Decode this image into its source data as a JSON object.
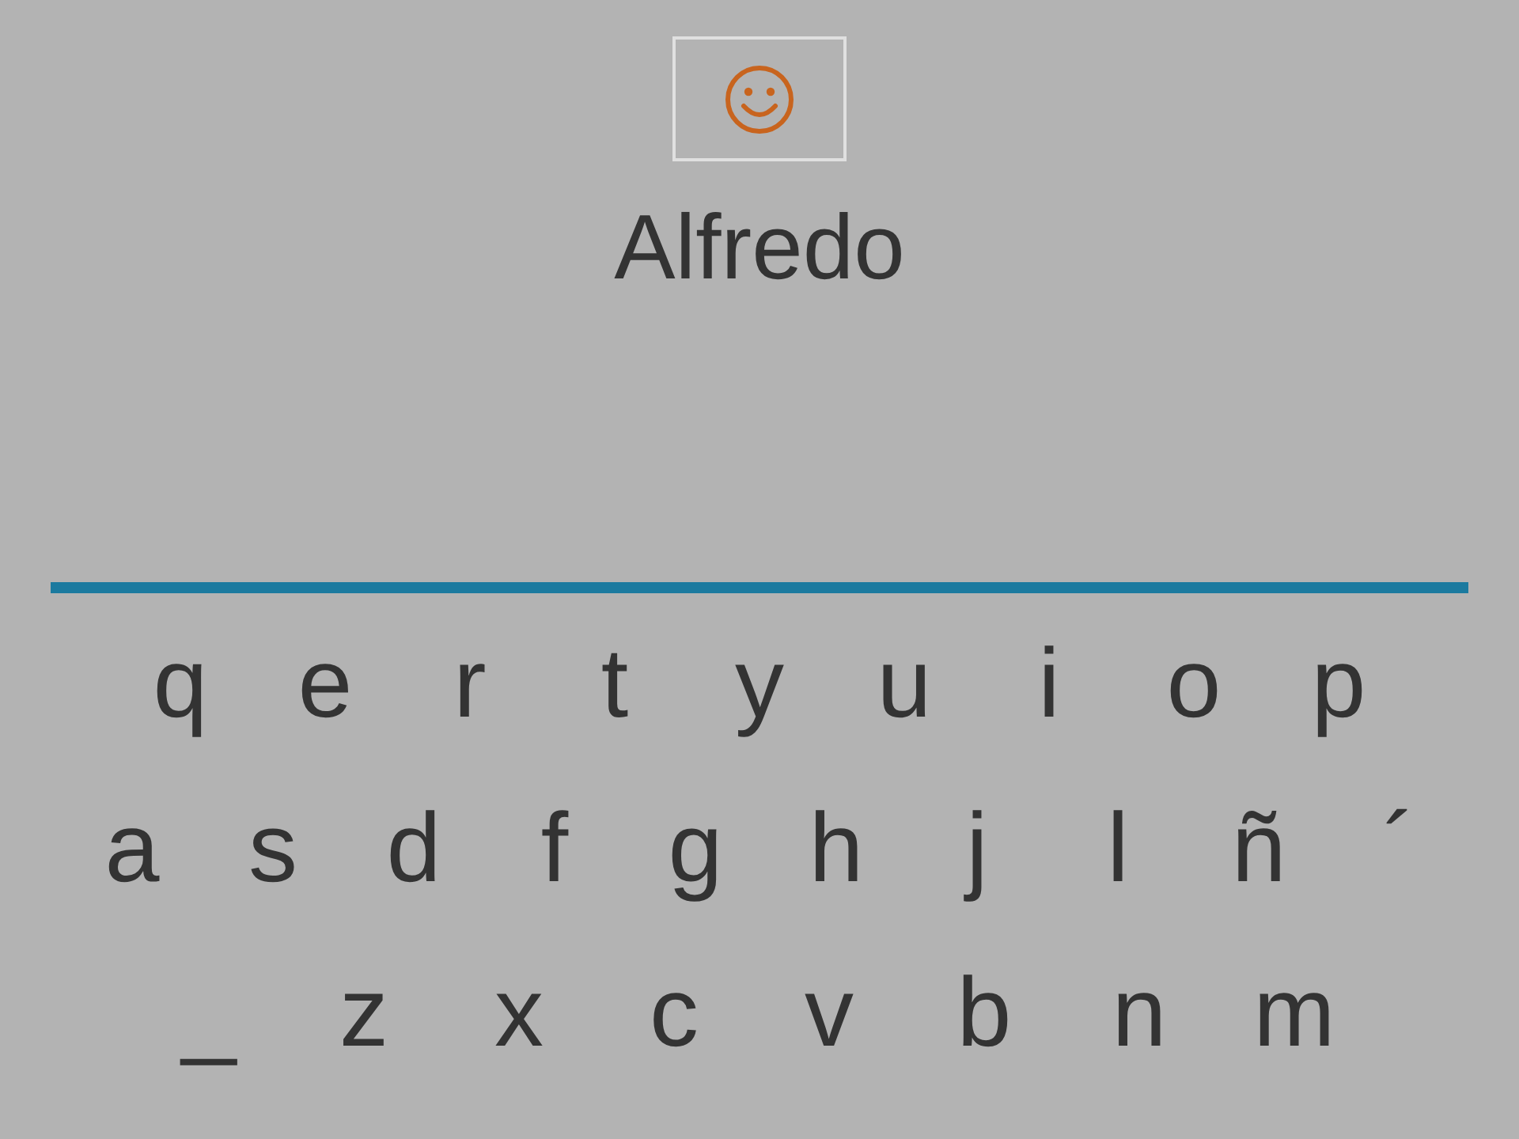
{
  "word": "Alfredo",
  "keyboard": {
    "rows": [
      [
        "q",
        "e",
        "r",
        "t",
        "y",
        "u",
        "i",
        "o",
        "p"
      ],
      [
        "a",
        "s",
        "d",
        "f",
        "g",
        "h",
        "j",
        "l",
        "ñ",
        "´"
      ],
      [
        "_",
        "z",
        "x",
        "c",
        "v",
        "b",
        "n",
        "m"
      ]
    ]
  }
}
